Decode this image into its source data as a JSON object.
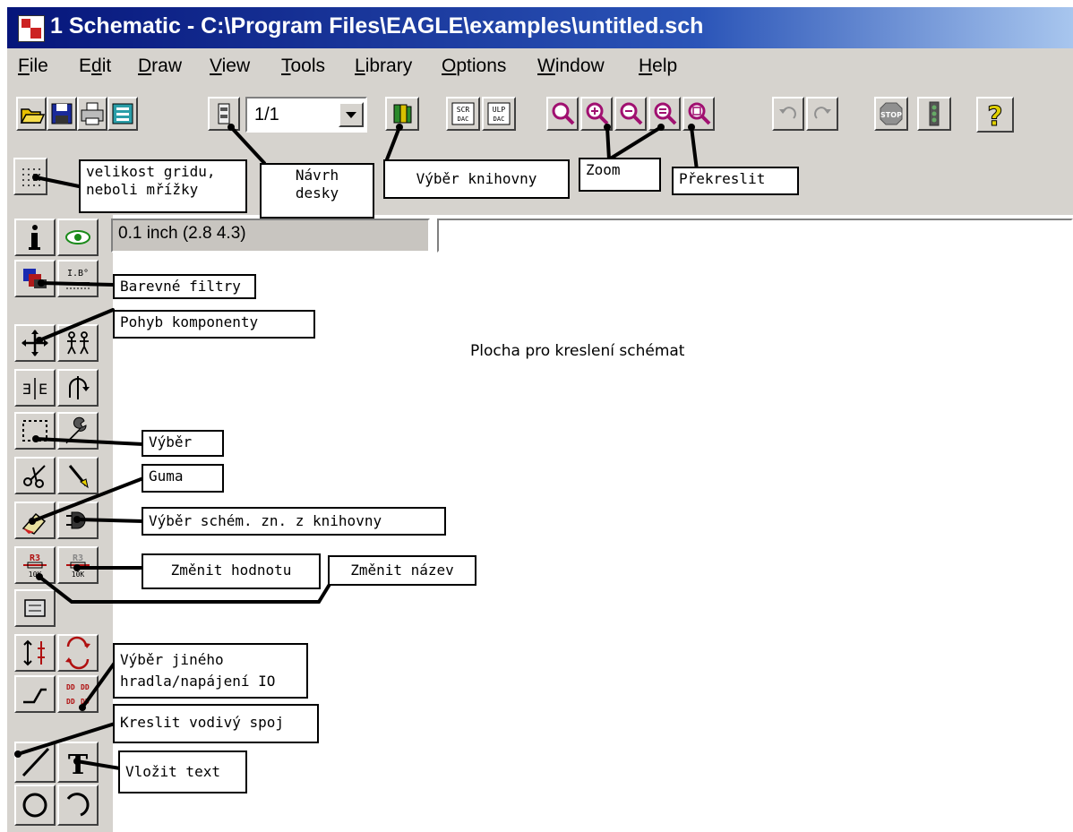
{
  "window": {
    "title": "1 Schematic - C:\\Program Files\\EAGLE\\examples\\untitled.sch"
  },
  "menu": [
    {
      "pre": "",
      "u": "F",
      "post": "ile"
    },
    {
      "pre": "E",
      "u": "d",
      "post": "it"
    },
    {
      "pre": "",
      "u": "D",
      "post": "raw"
    },
    {
      "pre": "",
      "u": "V",
      "post": "iew"
    },
    {
      "pre": "",
      "u": "T",
      "post": "ools"
    },
    {
      "pre": "",
      "u": "L",
      "post": "ibrary"
    },
    {
      "pre": "",
      "u": "O",
      "post": "ptions"
    },
    {
      "pre": "",
      "u": "W",
      "post": "indow"
    },
    {
      "pre": "",
      "u": "H",
      "post": "elp"
    }
  ],
  "toolbar": {
    "sheet_select": "1/1"
  },
  "status": {
    "coordinates": "0.1 inch (2.8 4.3)",
    "command": ""
  },
  "canvas": {
    "label": "Plocha pro kreslení schémat"
  },
  "callouts": {
    "grid": "velikost gridu,\nneboli mřížky",
    "board": "Návrh\ndesky",
    "library": "Výběr knihovny",
    "zoom": "Zoom",
    "redraw": "Překreslit",
    "color_filters": "Barevné filtry",
    "move": "Pohyb komponenty",
    "select": "Výběr",
    "eraser": "Guma",
    "add_symbol": "Výběr schém. zn. z knihovny",
    "change_value": "Změnit hodnotu",
    "change_name": "Změnit název",
    "gate_swap": "Výběr jiného\nhradla/napájení IO",
    "draw_wire": "Kreslit vodivý spoj",
    "insert_text": "Vložit text"
  },
  "icons": {
    "toolbar": [
      "open-folder-icon",
      "save-disk-icon",
      "print-icon",
      "cam-processor-icon",
      "board-switch-icon",
      "use-library-icon",
      "script-icon",
      "ulp-icon",
      "zoom-fit-icon",
      "zoom-in-icon",
      "zoom-out-icon",
      "redraw-icon",
      "zoom-select-icon",
      "undo-icon",
      "redo-icon",
      "stop-icon",
      "go-icon",
      "help-icon"
    ],
    "palette": [
      "info-icon",
      "show-icon",
      "display-layers-icon",
      "mark-icon",
      "move-icon",
      "copy-icon",
      "mirror-icon",
      "rotate-icon",
      "group-icon",
      "change-icon",
      "cut-icon",
      "paste-icon",
      "delete-icon",
      "add-icon",
      "value-icon",
      "name-icon",
      "smash-icon",
      "split-icon",
      "invoke-icon",
      "gateswap-icon",
      "pinswap-icon",
      "wire-icon",
      "text-icon",
      "circle-icon",
      "arc-icon"
    ]
  },
  "colors": {
    "titlebar_start": "#06157a",
    "titlebar_end": "#a8c6ee",
    "chrome": "#d6d3ce"
  }
}
